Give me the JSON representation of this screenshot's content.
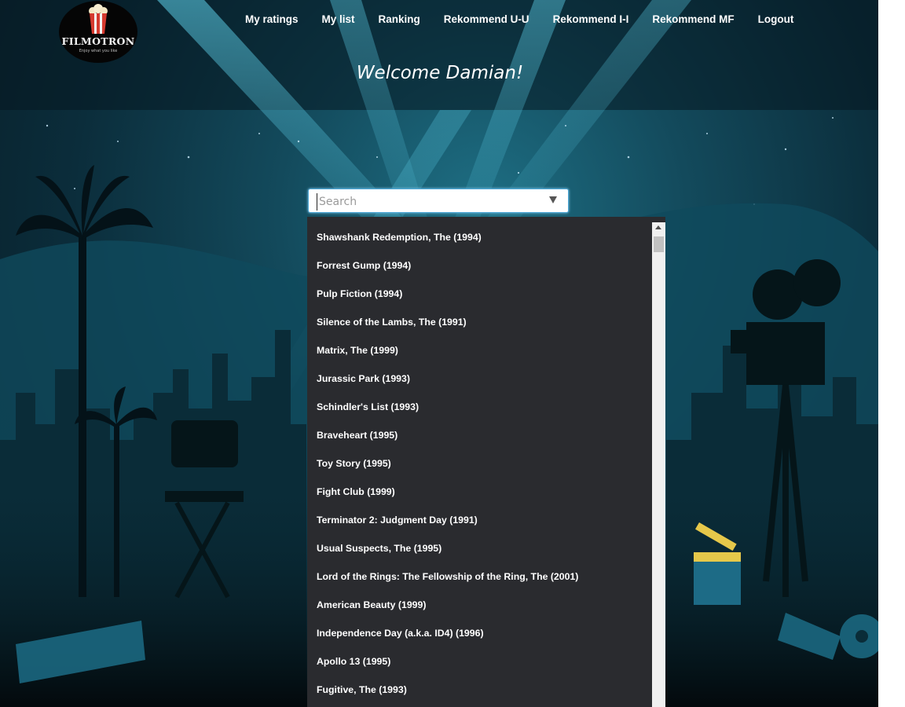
{
  "brand": {
    "name": "FILMOTRON",
    "tagline": "Enjoy what you like"
  },
  "nav": {
    "items": [
      {
        "label": "My ratings"
      },
      {
        "label": "My list"
      },
      {
        "label": "Ranking"
      },
      {
        "label": "Rekommend U-U"
      },
      {
        "label": "Rekommend I-I"
      },
      {
        "label": "Rekommend MF"
      },
      {
        "label": "Logout"
      }
    ]
  },
  "welcome": "Welcome Damian!",
  "search": {
    "placeholder": "Search",
    "value": ""
  },
  "dropdown": {
    "options": [
      "Shawshank Redemption, The (1994)",
      "Forrest Gump (1994)",
      "Pulp Fiction (1994)",
      "Silence of the Lambs, The (1991)",
      "Matrix, The (1999)",
      "Jurassic Park (1993)",
      "Schindler's List (1993)",
      "Braveheart (1995)",
      "Toy Story (1995)",
      "Fight Club (1999)",
      "Terminator 2: Judgment Day (1991)",
      "Usual Suspects, The (1995)",
      "Lord of the Rings: The Fellowship of the Ring, The (2001)",
      "American Beauty (1999)",
      "Independence Day (a.k.a. ID4) (1996)",
      "Apollo 13 (1995)",
      "Fugitive, The (1993)"
    ]
  },
  "colors": {
    "background": "#0b2d3b",
    "dropdown_bg": "#2a2b2f",
    "search_border": "#4ba6d6"
  }
}
